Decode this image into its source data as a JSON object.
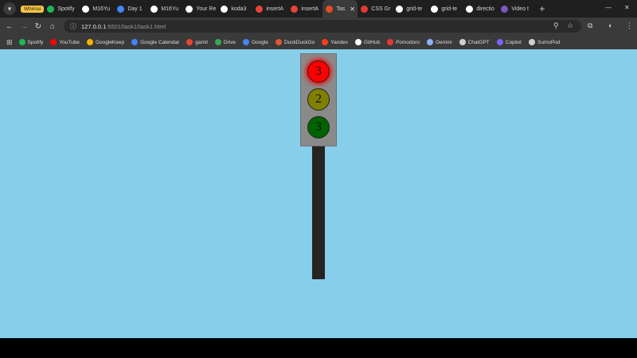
{
  "browser": {
    "tabs": [
      {
        "label": "Spotify",
        "icon": "spotify-icon",
        "color": "#1db954"
      },
      {
        "label": "M16Yu",
        "icon": "github-icon",
        "color": "#ffffff"
      },
      {
        "label": "Day 1",
        "icon": "docs-icon",
        "color": "#4285f4"
      },
      {
        "label": "M16Yu",
        "icon": "github-icon",
        "color": "#ffffff"
      },
      {
        "label": "Your Re",
        "icon": "github-icon",
        "color": "#ffffff"
      },
      {
        "label": "koda3",
        "icon": "github-icon",
        "color": "#ffffff"
      },
      {
        "label": "insertA",
        "icon": "google-icon",
        "color": "#ea4335"
      },
      {
        "label": "insertA",
        "icon": "google-icon",
        "color": "#ea4335"
      },
      {
        "label": "Tas",
        "icon": "vscode-icon",
        "color": "#e44d26",
        "active": true
      },
      {
        "label": "CSS Gr",
        "icon": "css-tricks-icon",
        "color": "#e53935"
      },
      {
        "label": "grid-te",
        "icon": "mdn-icon",
        "color": "#ffffff"
      },
      {
        "label": "grid-te",
        "icon": "mdn-icon",
        "color": "#ffffff"
      },
      {
        "label": "directio",
        "icon": "mdn-icon",
        "color": "#ffffff"
      },
      {
        "label": "Video t",
        "icon": "video-icon",
        "color": "#7e57c2"
      }
    ],
    "whimsical_label": "Whimsi",
    "new_tab_symbol": "+",
    "address": {
      "host": "127.0.0.1",
      "rest": ":5501/task1/task1.html"
    },
    "bookmarks": [
      {
        "label": "Spotify",
        "icon": "spotify-icon",
        "color": "#1db954"
      },
      {
        "label": "YouTube",
        "icon": "youtube-icon",
        "color": "#ff0000"
      },
      {
        "label": "GoogleKeep",
        "icon": "keep-icon",
        "color": "#f4b400"
      },
      {
        "label": "Google Calendar",
        "icon": "calendar-icon",
        "color": "#4285f4"
      },
      {
        "label": "gamil",
        "icon": "gmail-icon",
        "color": "#ea4335"
      },
      {
        "label": "Drive",
        "icon": "drive-icon",
        "color": "#34a853"
      },
      {
        "label": "Google",
        "icon": "google-icon",
        "color": "#4285f4"
      },
      {
        "label": "DuckDuckGo",
        "icon": "duckduckgo-icon",
        "color": "#de5833"
      },
      {
        "label": "Yandex",
        "icon": "yandex-icon",
        "color": "#fc3f1d"
      },
      {
        "label": "GitHub",
        "icon": "github-icon",
        "color": "#ffffff"
      },
      {
        "label": "Pomodoro",
        "icon": "pomodoro-icon",
        "color": "#e53935"
      },
      {
        "label": "Gemini",
        "icon": "gemini-icon",
        "color": "#8ab4f8"
      },
      {
        "label": "ChatGPT",
        "icon": "chatgpt-icon",
        "color": "#d0d0d0"
      },
      {
        "label": "Copilot",
        "icon": "copilot-icon",
        "color": "#7b61ff"
      },
      {
        "label": "SumoPod",
        "icon": "sumopod-icon",
        "color": "#d0d0d0"
      }
    ]
  },
  "page": {
    "background": "#87ceeb",
    "lights": [
      {
        "label": "3",
        "color": "#ff0000",
        "lit": true
      },
      {
        "label": "2",
        "color": "#808000",
        "lit": false
      },
      {
        "label": "3",
        "color": "#006400",
        "lit": false
      }
    ],
    "housing_color": "#8a8a8a",
    "pole_color": "#262322"
  }
}
